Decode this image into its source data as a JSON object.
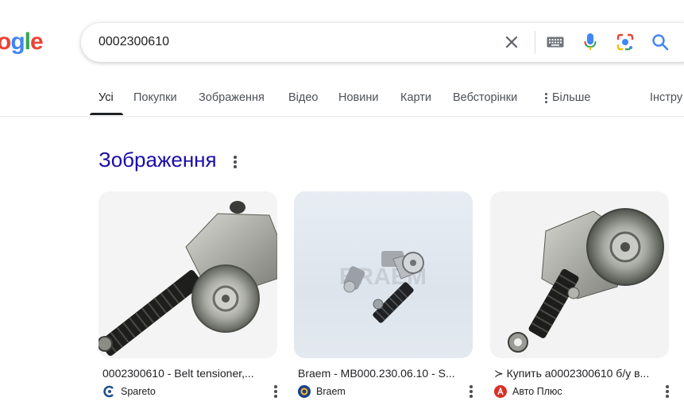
{
  "logo": {
    "text_o": "o",
    "text_g": "g",
    "text_l": "l",
    "text_e": "e"
  },
  "search": {
    "query": "0002300610"
  },
  "tabs": [
    {
      "label": "Усі"
    },
    {
      "label": "Покупки"
    },
    {
      "label": "Зображення"
    },
    {
      "label": "Відео"
    },
    {
      "label": "Новини"
    },
    {
      "label": "Карти"
    },
    {
      "label": "Вебсторінки"
    },
    {
      "label": "Більше"
    },
    {
      "label": "Інстру"
    }
  ],
  "images_section": {
    "title": "Зображення",
    "results": [
      {
        "caption": "0002300610 - Belt tensioner,...",
        "source": "Spareto",
        "watermark": ""
      },
      {
        "caption": "Braem - MB000.230.06.10 - S...",
        "source": "Braem",
        "watermark": "BRAEM"
      },
      {
        "caption": "≻ Купить a0002300610 б/у в...",
        "source": "Авто Плюс",
        "watermark": ""
      }
    ]
  },
  "colors": {
    "link": "#1a0dab",
    "blue": "#4285f4",
    "red": "#ea4335",
    "yellow": "#fbbc05",
    "green": "#34a853"
  }
}
